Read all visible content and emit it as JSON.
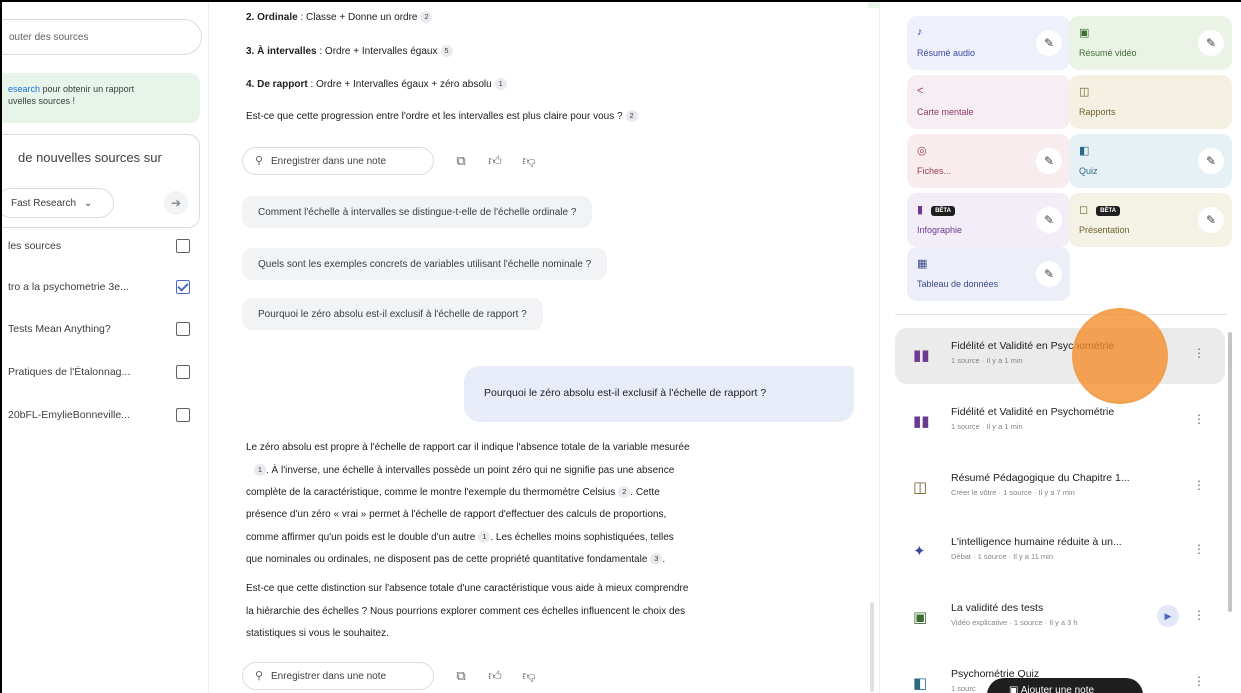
{
  "sources_panel": {
    "search_placeholder": "outer des sources",
    "research_note_link": "esearch",
    "research_note_line1": " pour obtenir un rapport",
    "research_note_line2": "uvelles sources !",
    "discover_title": "de nouvelles sources sur",
    "fast_research_label": "Fast Research",
    "go_icon": "arrow-right-icon",
    "select_all_label": "les sources",
    "items": [
      {
        "label": "tro a la psychometrie 3e...",
        "checked": true
      },
      {
        "label": "Tests Mean Anything?",
        "checked": false
      },
      {
        "label": "Pratiques de l'Étalonnag...",
        "checked": false
      },
      {
        "label": "20bFL-EmylieBonneville...",
        "checked": false
      }
    ]
  },
  "chat": {
    "scale_ordinal_num": "2. Ordinale",
    "scale_ordinal_text": " : Classe + Donne un ordre",
    "scale_ordinal_cite": "2",
    "scale_interval_num": "3. À intervalles",
    "scale_interval_text": " : Ordre + Intervalles égaux",
    "scale_interval_cite": "5",
    "scale_ratio_num": "4. De rapport",
    "scale_ratio_text": " : Ordre + Intervalles égaux + zéro absolu",
    "scale_ratio_cite": "1",
    "question_1": "Est-ce que cette progression entre l'ordre et les intervalles est plus claire pour vous ?",
    "question_1_cite": "2",
    "save_note_label": "Enregistrer dans une note",
    "suggestions": [
      "Comment l'échelle à intervalles se distingue-t-elle de l'échelle ordinale ?",
      "Quels sont les exemples concrets de variables utilisant l'échelle nominale ?",
      "Pourquoi le zéro absolu est-il exclusif à l'échelle de rapport ?"
    ],
    "user_message": "Pourquoi le zéro absolu est-il exclusif à l'échelle de rapport ?",
    "answer_p1_l1": "Le zéro absolu est propre à l'échelle de rapport car il indique l'absence totale de la variable mesurée",
    "answer_p1_l2_cite": "1",
    "answer_p1_l2": ". À l'inverse, une échelle à intervalles possède un point zéro qui ne signifie pas une absence",
    "answer_p1_l3": "complète de la caractéristique, comme le montre l'exemple du thermomètre Celsius",
    "answer_p1_l3_cite": "2",
    "answer_p1_l3_end": ". Cette",
    "answer_p1_l4": "présence d'un zéro « vrai » permet à l'échelle de rapport d'effectuer des calculs de proportions,",
    "answer_p1_l5": "comme affirmer qu'un poids est le double d'un autre",
    "answer_p1_l5_cite": "1",
    "answer_p1_l5_end": ". Les échelles moins sophistiquées, telles",
    "answer_p1_l6": "que nominales ou ordinales, ne disposent pas de cette propriété quantitative fondamentale",
    "answer_p1_l6_cite": "3",
    "answer_p1_l6_end": ".",
    "answer_p2_l1": "Est-ce que cette distinction sur l'absence totale d'une caractéristique vous aide à mieux comprendre",
    "answer_p2_l2": "la hiérarchie des échelles ? Nous pourrions explorer comment ces échelles influencent le choix des",
    "answer_p2_l3": "statistiques si vous le souhaitez."
  },
  "studio": {
    "tiles": [
      {
        "label": "Résumé audio",
        "icon": "audio-waveform-icon",
        "glyph": "♪"
      },
      {
        "label": "Résumé vidéo",
        "icon": "video-icon",
        "glyph": "▣"
      },
      {
        "label": "Carte mentale",
        "icon": "mind-map-icon",
        "glyph": "<"
      },
      {
        "label": "Rapports",
        "icon": "report-icon",
        "glyph": "◫"
      },
      {
        "label": "Fiches...",
        "icon": "flashcards-icon",
        "glyph": "◎"
      },
      {
        "label": "Quiz",
        "icon": "quiz-icon",
        "glyph": "◧"
      },
      {
        "label": "Infographie",
        "icon": "infographic-icon",
        "glyph": "▮",
        "badge": "BÊTA"
      },
      {
        "label": "Présentation",
        "icon": "presentation-icon",
        "glyph": "◻",
        "badge": "BÊTA"
      },
      {
        "label": "Tableau de données",
        "icon": "data-table-icon",
        "glyph": "▦"
      }
    ],
    "notes": [
      {
        "title": "Fidélité et Validité en Psychométrie",
        "meta": "1 source · Il y a 1 min",
        "icon": "infographic-icon",
        "glyph": "▮▮",
        "active": true
      },
      {
        "title": "Fidélité et Validité en Psychométrie",
        "meta": "1 source · Il y a 1 min",
        "icon": "infographic-icon",
        "glyph": "▮▮"
      },
      {
        "title": "Résumé Pédagogique du Chapitre 1...",
        "meta": "Créer le vôtre · 1 source · Il y a 7 min",
        "icon": "report-icon",
        "glyph": "◫"
      },
      {
        "title": "L'intelligence humaine réduite à un...",
        "meta": "Débat · 1 source · Il y a 11 min",
        "icon": "audio-waveform-icon",
        "glyph": "✦"
      },
      {
        "title": "La validité des tests",
        "meta": "Vidéo explicative · 1 source · Il y a 3 h",
        "icon": "video-icon",
        "glyph": "▣",
        "play": true
      },
      {
        "title": "Psychométrie Quiz",
        "meta": "1 sourc",
        "icon": "quiz-icon",
        "glyph": "◧"
      }
    ],
    "add_note_label": "Ajouter une note",
    "accent": "#f48c28"
  }
}
